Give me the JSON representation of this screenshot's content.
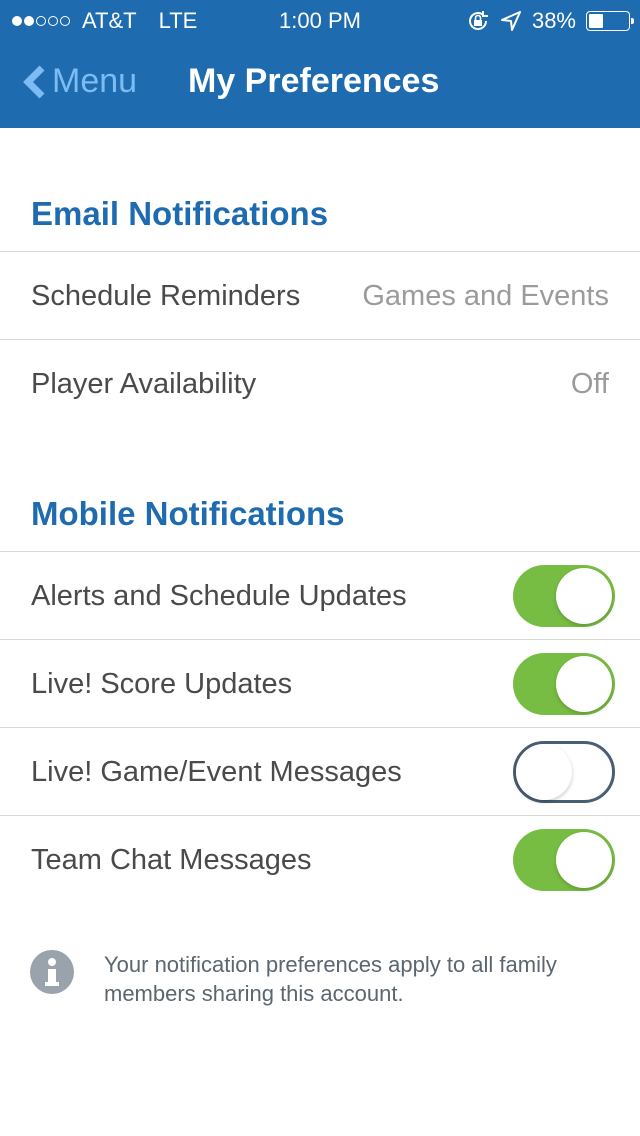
{
  "status_bar": {
    "signal_filled": 2,
    "signal_total": 5,
    "carrier": "AT&T",
    "network": "LTE",
    "time": "1:00 PM",
    "battery_percent_text": "38%",
    "battery_level": 0.38,
    "icons": [
      "rotation-lock-icon",
      "location-arrow-icon",
      "battery-icon"
    ]
  },
  "nav": {
    "back_label": "Menu",
    "title": "My Preferences"
  },
  "colors": {
    "brand_blue": "#1f6bb0",
    "back_link": "#7cbcf2",
    "toggle_on": "#78bd43",
    "toggle_off_border": "#4a5e73"
  },
  "email_section": {
    "heading": "Email Notifications",
    "rows": [
      {
        "label": "Schedule Reminders",
        "value": "Games and Events"
      },
      {
        "label": "Player Availability",
        "value": "Off"
      }
    ]
  },
  "mobile_section": {
    "heading": "Mobile Notifications",
    "rows": [
      {
        "label": "Alerts and Schedule Updates",
        "enabled": true
      },
      {
        "label": "Live! Score Updates",
        "enabled": true
      },
      {
        "label": "Live! Game/Event Messages",
        "enabled": false
      },
      {
        "label": "Team Chat Messages",
        "enabled": true
      }
    ]
  },
  "info": {
    "icon": "info-icon",
    "text": "Your notification preferences apply to all family members sharing this account."
  }
}
